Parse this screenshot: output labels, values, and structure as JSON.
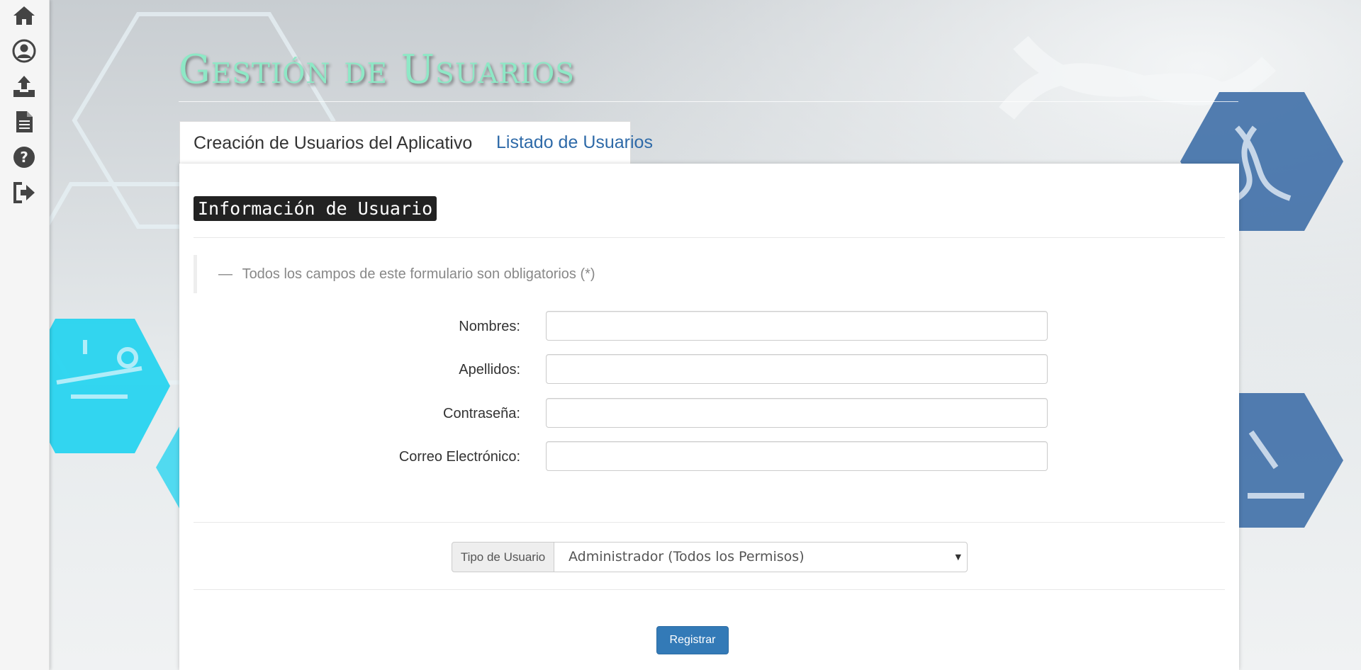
{
  "sidebar": {
    "items": [
      {
        "icon": "home-icon"
      },
      {
        "icon": "user-icon"
      },
      {
        "icon": "upload-icon"
      },
      {
        "icon": "document-icon"
      },
      {
        "icon": "help-icon"
      },
      {
        "icon": "logout-icon"
      }
    ]
  },
  "header": {
    "title": "Gestión de Usuarios"
  },
  "tabs": [
    {
      "label": "Creación de Usuarios del Aplicativo",
      "active": true
    },
    {
      "label": "Listado de Usuarios",
      "active": false
    }
  ],
  "form": {
    "section_title": "Información de Usuario",
    "note_prefix": "—",
    "note": "Todos los campos de este formulario son obligatorios (*)",
    "fields": [
      {
        "label": "Nombres:",
        "value": ""
      },
      {
        "label": "Apellidos:",
        "value": ""
      },
      {
        "label": "Contraseña:",
        "value": ""
      },
      {
        "label": "Correo Electrónico:",
        "value": ""
      }
    ],
    "user_type": {
      "label": "Tipo de Usuario",
      "selected": "Administrador (Todos los Permisos)"
    },
    "submit_label": "Registrar"
  },
  "colors": {
    "title": "#8ee8c6",
    "primary_button": "#337ab7",
    "tab_link": "#2e6aa8",
    "hexagon_cyan": "#1ed3f0",
    "hexagon_blue": "#3f6fa7"
  }
}
